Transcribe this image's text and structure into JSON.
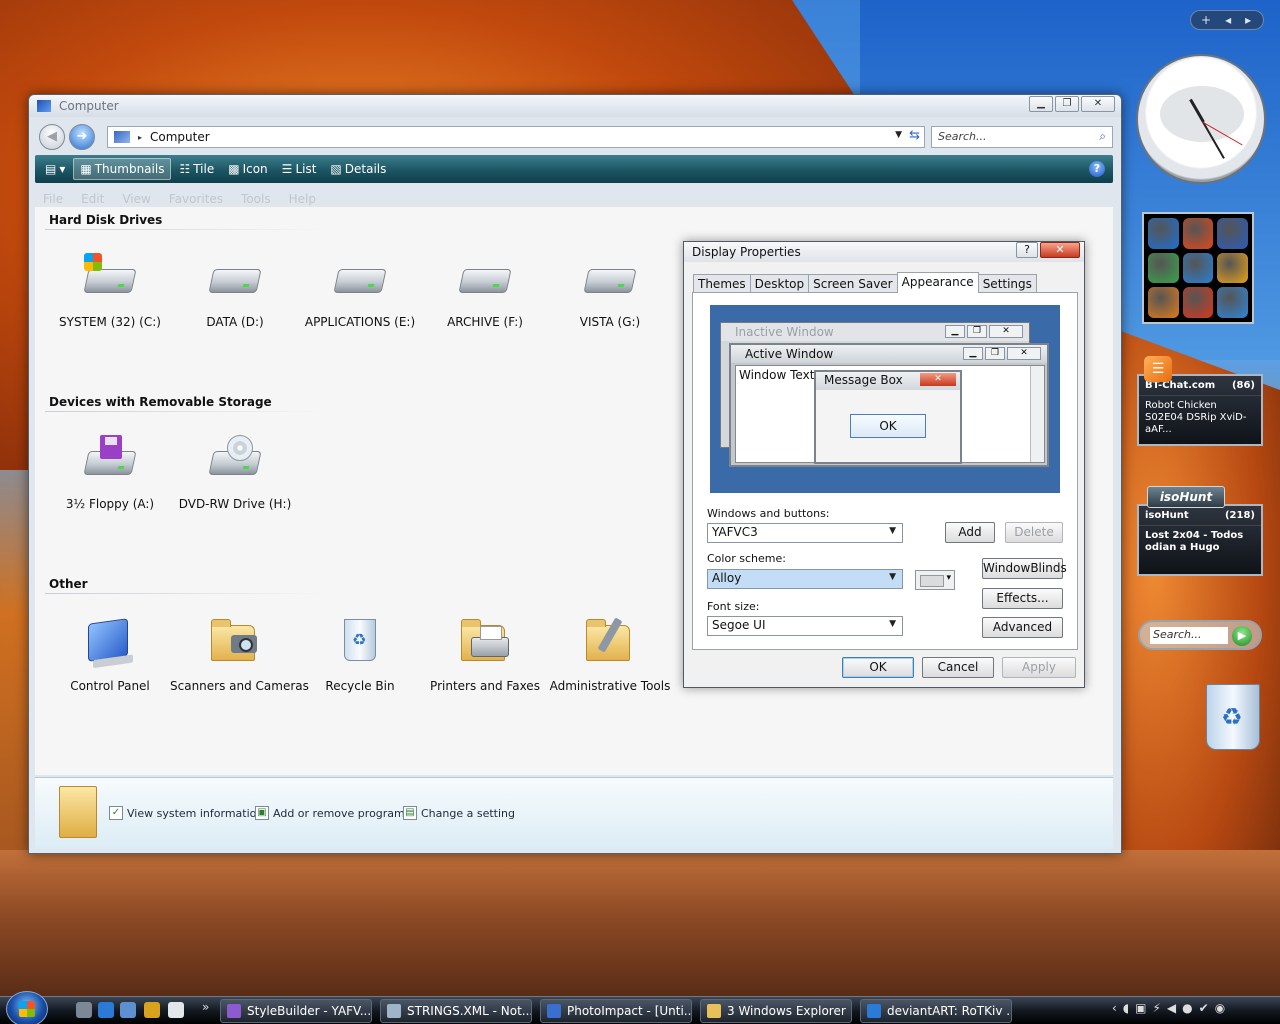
{
  "explorer": {
    "title": "Computer",
    "address": "Computer",
    "search_placeholder": "Search...",
    "toolbar": [
      {
        "label": "Thumbnails",
        "icon": "thumbnails-icon",
        "active": true
      },
      {
        "label": "Tile",
        "icon": "tile-icon",
        "active": false
      },
      {
        "label": "Icon",
        "icon": "icon-view-icon",
        "active": false
      },
      {
        "label": "List",
        "icon": "list-icon",
        "active": false
      },
      {
        "label": "Details",
        "icon": "details-icon",
        "active": false
      }
    ],
    "menu": [
      "File",
      "Edit",
      "View",
      "Favorites",
      "Tools",
      "Help"
    ],
    "groups": {
      "hdd": "Hard Disk Drives",
      "removable": "Devices with Removable Storage",
      "other": "Other"
    },
    "drives": [
      {
        "label": "SYSTEM (32) (C:)"
      },
      {
        "label": "DATA (D:)"
      },
      {
        "label": "APPLICATIONS (E:)"
      },
      {
        "label": "ARCHIVE (F:)"
      },
      {
        "label": "VISTA (G:)"
      }
    ],
    "removable": [
      {
        "label": "3½ Floppy (A:)"
      },
      {
        "label": "DVD-RW Drive (H:)"
      }
    ],
    "other": [
      {
        "label": "Control Panel"
      },
      {
        "label": "Scanners and Cameras"
      },
      {
        "label": "Recycle Bin"
      },
      {
        "label": "Printers and Faxes"
      },
      {
        "label": "Administrative Tools"
      }
    ],
    "tasks": [
      {
        "label": "View system information"
      },
      {
        "label": "Add or remove programs"
      },
      {
        "label": "Change a setting"
      }
    ]
  },
  "dialog": {
    "title": "Display Properties",
    "help_glyph": "?",
    "close_glyph": "✕",
    "tabs": [
      "Themes",
      "Desktop",
      "Screen Saver",
      "Appearance",
      "Settings"
    ],
    "active_tab": "Appearance",
    "preview": {
      "inactive_title": "Inactive Window",
      "active_title": "Active Window",
      "window_text": "Window Text",
      "message_title": "Message Box",
      "ok": "OK"
    },
    "windows_buttons_label": "Windows and buttons:",
    "windows_buttons_value": "YAFVC3",
    "color_scheme_label": "Color scheme:",
    "color_scheme_value": "Alloy",
    "font_size_label": "Font size:",
    "font_size_value": "Segoe UI",
    "buttons": {
      "add": "Add",
      "delete": "Delete",
      "windowblinds": "WindowBlinds",
      "effects": "Effects...",
      "advanced": "Advanced",
      "ok": "OK",
      "cancel": "Cancel",
      "apply": "Apply"
    }
  },
  "gadgets": {
    "sidebar_controls": [
      "+",
      "◂",
      "▸"
    ],
    "feeds": [
      {
        "site": "BT-Chat.com",
        "count": "(86)",
        "text": "Robot Chicken S02E04 DSRip XviD-aAF..."
      },
      {
        "site": "isoHunt",
        "count": "(218)",
        "text": "Lost 2x04 - Todos odian a Hugo"
      }
    ],
    "search_placeholder": "Search...",
    "iso_logo": "isoHunt",
    "launcher_colors": [
      "#1d6fd6",
      "#e0481b",
      "#2b5bb8",
      "#3aa34b",
      "#2a7fd4",
      "#e8a11a",
      "#e07b1a",
      "#d6381c",
      "#2f86d9"
    ]
  },
  "taskbar": {
    "buttons": [
      {
        "label": "StyleBuilder - YAFV..."
      },
      {
        "label": "STRINGS.XML - Not..."
      },
      {
        "label": "PhotoImpact - [Unti..."
      },
      {
        "label": "3 Windows Explorer"
      },
      {
        "label": "deviantART: RoTKiv ..."
      }
    ],
    "more_glyph": "»"
  },
  "colors": {
    "toolbar": "#1c5563",
    "accent": "#2b66c8"
  }
}
